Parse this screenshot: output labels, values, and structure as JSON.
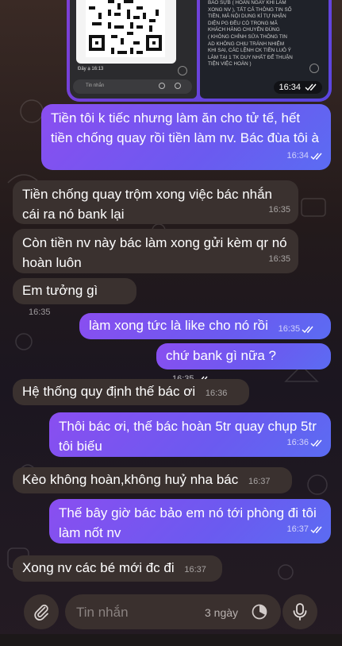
{
  "media": {
    "left": {
      "sender": "Đây ạ",
      "time": "16:13",
      "input_placeholder": "Tin nhắn"
    },
    "right": {
      "lines": [
        "BÁO SỰB ( HOÀN NGAY KHI LÀM",
        "XONG NV ), TẤT CẢ THÔNG TIN SỐ",
        "TIỀN, MÃ NỘI DUNG KÍ TỰ NHẬN",
        "DIỆN PG ĐỀU CÓ TRONG MÃ",
        "KHÁCH HÀNG CHUYÊN ĐÚNG",
        "( KHÔNG CHỈNH SỬA THÔNG TIN",
        "AD KHÔNG CHỊU TRÁNH NHIỆM",
        "KHI SAI, CÁC LỆNH CK TIỀN LUÔ Ý",
        "LÀM TẠI 1 TK DUY NHẤT ĐỂ THUẬN",
        "TIỆN VIỆC HOÀN )"
      ],
      "time": "16:34"
    }
  },
  "messages": [
    {
      "dir": "out",
      "text": "Tiền tôi k tiếc nhưng làm ăn cho tử tế, hết tiền chống quay rồi tiền làm nv. Bác đùa tôi à",
      "time": "16:34"
    },
    {
      "dir": "in",
      "text": "Tiền chống quay trộm xong việc bác nhắn cái ra nó bank lại",
      "time": "16:35"
    },
    {
      "dir": "in",
      "text": "Còn tiền nv này bác làm xong gửi kèm qr nó hoàn luôn",
      "time": "16:35"
    },
    {
      "dir": "in",
      "text": "Em tưởng gì",
      "time": "16:35"
    },
    {
      "dir": "out",
      "text": "làm xong tức là like cho nó rồi",
      "time": "16:35"
    },
    {
      "dir": "out",
      "text": "chứ bank gì nữa ?",
      "time": "16:35"
    },
    {
      "dir": "in",
      "text": "Hệ thống quy định thế bác ơi",
      "time": "16:36"
    },
    {
      "dir": "out",
      "text": "Thôi bác ơi, thế bác hoàn 5tr quay chụp 5tr tôi biếu",
      "time": "16:36"
    },
    {
      "dir": "in",
      "text": "Kèo không hoàn,không huỷ nha bác",
      "time": "16:37"
    },
    {
      "dir": "out",
      "text": "Thế bây giờ bác bảo em nó tới phòng đi tôi làm nốt nv",
      "time": "16:37"
    },
    {
      "dir": "in",
      "text": "Xong nv các bé mới đc đi",
      "time": "16:37"
    }
  ],
  "composer": {
    "placeholder": "Tin nhắn",
    "timer_label": "3 ngày",
    "icons": [
      "paperclip-icon",
      "timer-icon",
      "microphone-icon"
    ]
  },
  "colors": {
    "outgoing": "#7a55f0",
    "incoming": "#3a312f",
    "background": "#231a1b"
  }
}
